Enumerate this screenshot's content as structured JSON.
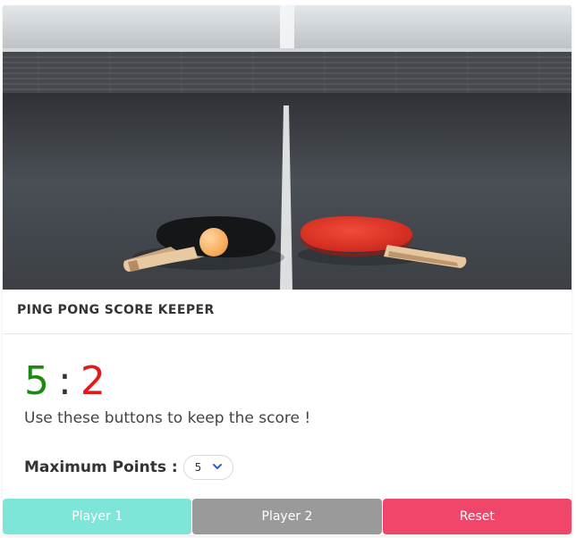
{
  "card": {
    "title": "PING PONG SCORE KEEPER"
  },
  "score": {
    "player1": "5",
    "separator": ":",
    "player2": "2"
  },
  "instructions": "Use these buttons to keep the score !",
  "max_points": {
    "label": "Maximum Points :",
    "selected": "5"
  },
  "buttons": {
    "player1": "Player 1",
    "player2": "Player 2",
    "reset": "Reset"
  },
  "colors": {
    "player1": "#1c8a12",
    "player2": "#e31a1a",
    "btn_player1": "#7ee6d8",
    "btn_player2": "#9a9a9a",
    "btn_reset": "#f0466a"
  }
}
